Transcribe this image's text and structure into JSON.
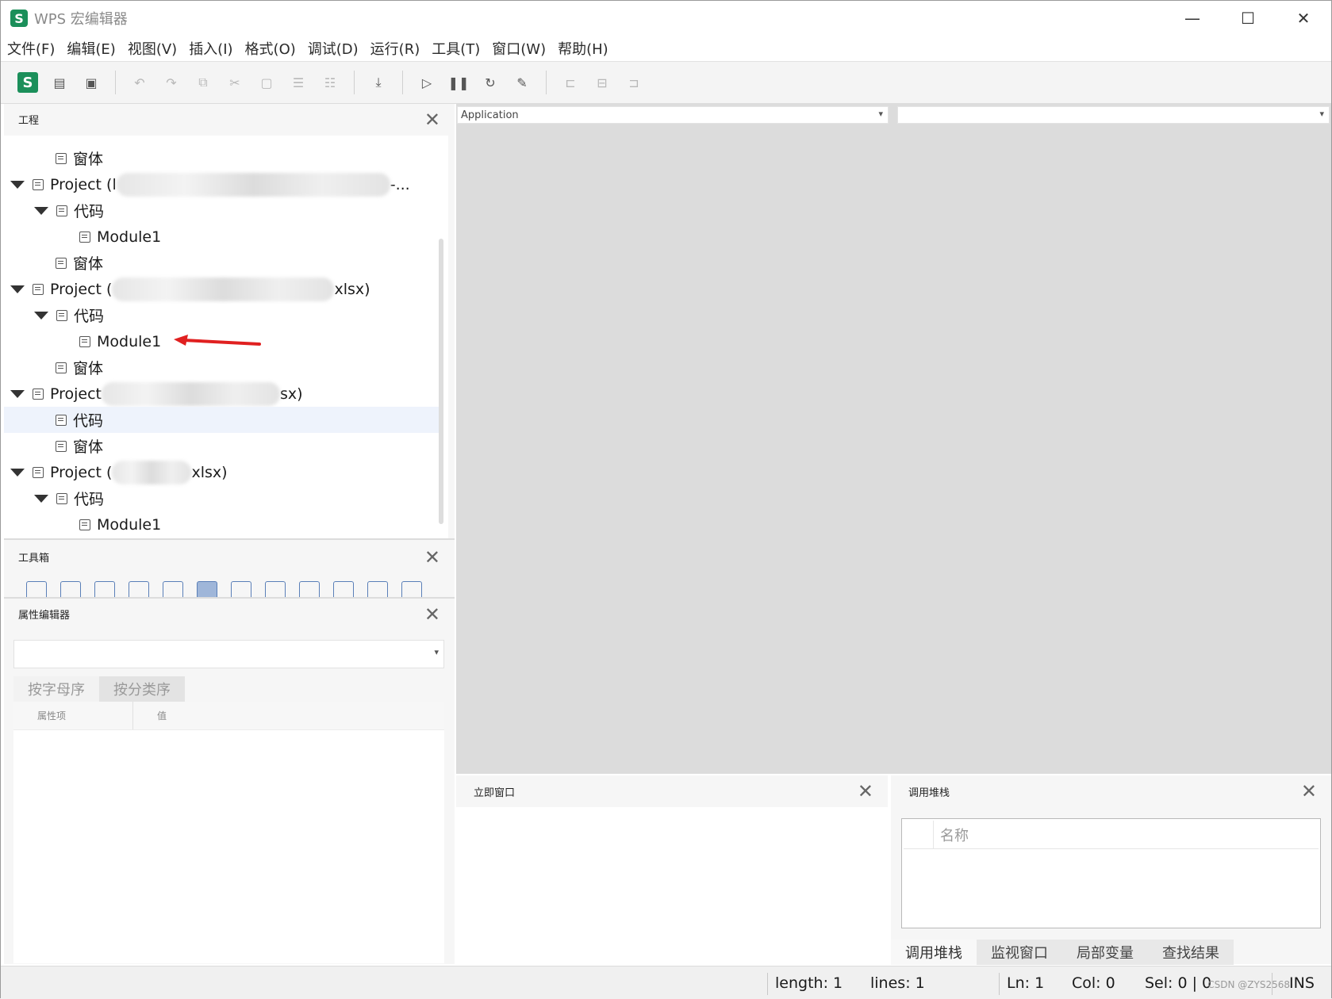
{
  "window": {
    "title": "WPS 宏编辑器",
    "logo_letter": "S",
    "controls": {
      "minimize": "—",
      "maximize": "☐",
      "close": "✕"
    }
  },
  "menu": [
    "文件(F)",
    "编辑(E)",
    "视图(V)",
    "插入(I)",
    "格式(O)",
    "调试(D)",
    "运行(R)",
    "工具(T)",
    "窗口(W)",
    "帮助(H)"
  ],
  "toolbar": {
    "logo_letter": "S",
    "buttons": [
      {
        "icon": "new-file-icon",
        "glyph": "▤"
      },
      {
        "icon": "save-icon",
        "glyph": "▣"
      },
      {
        "icon": "undo-icon",
        "glyph": "↶"
      },
      {
        "icon": "redo-icon",
        "glyph": "↷"
      },
      {
        "icon": "copy-icon",
        "glyph": "⧉"
      },
      {
        "icon": "cut-icon",
        "glyph": "✂"
      },
      {
        "icon": "paste-icon",
        "glyph": "▢"
      },
      {
        "icon": "indent-icon",
        "glyph": "☰"
      },
      {
        "icon": "outdent-icon",
        "glyph": "☷"
      },
      {
        "icon": "import-icon",
        "glyph": "⤓"
      },
      {
        "icon": "run-icon",
        "glyph": "▷"
      },
      {
        "icon": "pause-icon",
        "glyph": "❚❚"
      },
      {
        "icon": "reset-icon",
        "glyph": "↻"
      },
      {
        "icon": "design-mode-icon",
        "glyph": "✎"
      },
      {
        "icon": "align-left-icon",
        "glyph": "⊏"
      },
      {
        "icon": "align-center-icon",
        "glyph": "⊟"
      },
      {
        "icon": "distribute-icon",
        "glyph": "⊐"
      }
    ]
  },
  "project_panel": {
    "title": "工程",
    "close": "✕",
    "tree": [
      {
        "label": "窗体",
        "suffix": ""
      },
      {
        "label": "Project (l",
        "suffix": "-..."
      },
      {
        "label": "代码",
        "suffix": ""
      },
      {
        "label": "Module1",
        "suffix": ""
      },
      {
        "label": "窗体",
        "suffix": ""
      },
      {
        "label": "Project (",
        "suffix": "xlsx)"
      },
      {
        "label": "代码",
        "suffix": ""
      },
      {
        "label": "Module1",
        "suffix": ""
      },
      {
        "label": "窗体",
        "suffix": ""
      },
      {
        "label": "Project",
        "suffix": "sx)"
      },
      {
        "label": "代码",
        "suffix": ""
      },
      {
        "label": "窗体",
        "suffix": ""
      },
      {
        "label": "Project (",
        "suffix": "xlsx)"
      },
      {
        "label": "代码",
        "suffix": ""
      },
      {
        "label": "Module1",
        "suffix": ""
      }
    ]
  },
  "toolbox_panel": {
    "title": "工具箱",
    "close": "✕"
  },
  "props_panel": {
    "title": "属性编辑器",
    "close": "✕",
    "tab_alpha": "按字母序",
    "tab_category": "按分类序",
    "col_property": "属性项",
    "col_value": "值"
  },
  "code_area": {
    "object_select": "Application",
    "proc_select": ""
  },
  "immediate_panel": {
    "title": "立即窗口",
    "close": "✕"
  },
  "callstack_panel": {
    "title": "调用堆栈",
    "close": "✕",
    "col_name": "名称",
    "tabs": [
      "调用堆栈",
      "监视窗口",
      "局部变量",
      "查找结果"
    ]
  },
  "status": {
    "length": "length: 1",
    "lines": "lines: 1",
    "ln": "Ln: 1",
    "col": "Col: 0",
    "sel": "Sel: 0 | 0",
    "mode": "INS",
    "watermark": "CSDN @ZYS2568"
  },
  "colors": {
    "accent": "#1b8f5a",
    "selection": "#eef3fc",
    "arrow": "#e02020"
  }
}
